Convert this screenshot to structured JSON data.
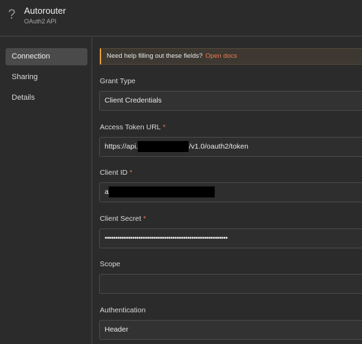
{
  "header": {
    "icon": "question-mark-icon",
    "icon_glyph": "?",
    "title": "Autorouter",
    "subtitle": "OAuth2 API"
  },
  "sidebar": {
    "items": [
      {
        "label": "Connection",
        "active": true
      },
      {
        "label": "Sharing",
        "active": false
      },
      {
        "label": "Details",
        "active": false
      }
    ]
  },
  "notice": {
    "text": "Need help filling out these fields?",
    "link": "Open docs",
    "accent_color": "#e6a23c"
  },
  "form": {
    "grant_type": {
      "label": "Grant Type",
      "value": "Client Credentials"
    },
    "access_token_url": {
      "label": "Access Token URL",
      "required_mark": "*",
      "value_prefix": "https://api.",
      "value_suffix": "/v1.0/oauth2/token"
    },
    "client_id": {
      "label": "Client ID",
      "required_mark": "*",
      "value_prefix": "a"
    },
    "client_secret": {
      "label": "Client Secret",
      "required_mark": "*",
      "value": "••••••••••••••••••••••••••••••••••••••••••••••••••••••••••"
    },
    "scope": {
      "label": "Scope",
      "value": ""
    },
    "authentication": {
      "label": "Authentication",
      "value": "Header"
    }
  }
}
